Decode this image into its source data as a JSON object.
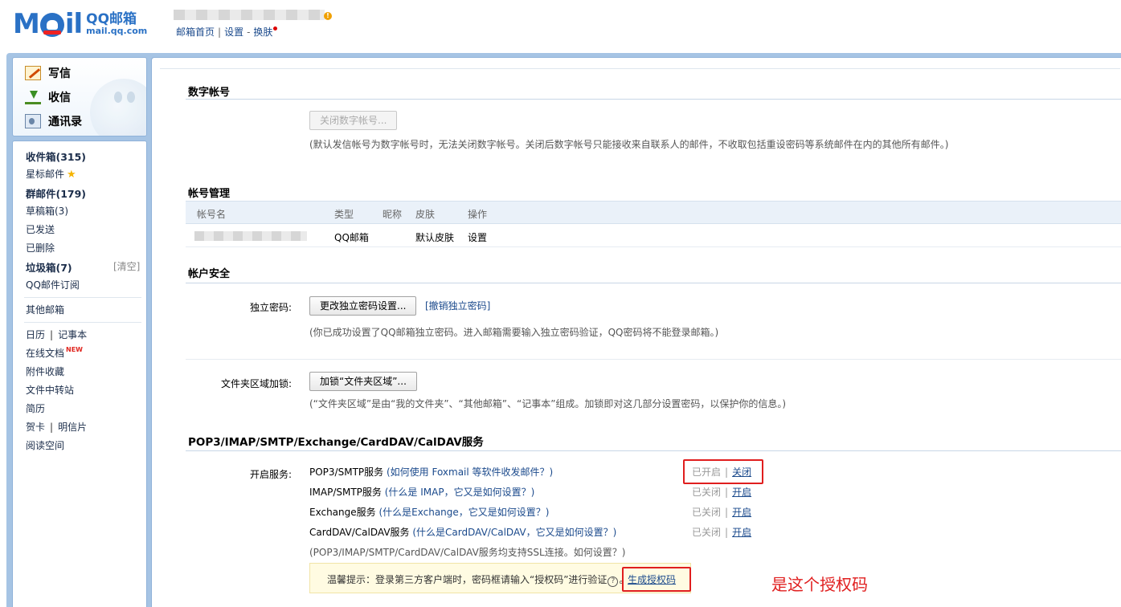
{
  "header": {
    "logo_word": "M",
    "logo_word_tail": "il",
    "logo_title": "QQ邮箱",
    "logo_domain": "mail.qq.com",
    "links": [
      "邮箱首页",
      "设置",
      "换肤"
    ],
    "sep_bar": "|",
    "sep_dash": "-"
  },
  "sidebar": {
    "quick": [
      {
        "label": "写信",
        "icon": "write-icon"
      },
      {
        "label": "收信",
        "icon": "inbox-download-icon"
      },
      {
        "label": "通讯录",
        "icon": "contacts-card-icon"
      }
    ],
    "folders": {
      "inbox": "收件箱(315)",
      "starred": "星标邮件",
      "group": "群邮件(179)",
      "drafts": "草稿箱(3)",
      "sent": "已发送",
      "deleted": "已删除",
      "spam": "垃圾箱(7)",
      "spam_clear": "[清空]",
      "subscription": "QQ邮件订阅",
      "other_mailbox": "其他邮箱",
      "calendar": "日历",
      "notes": "记事本",
      "docs": "在线文档",
      "docs_badge": "NEW",
      "attachments": "附件收藏",
      "transfer": "文件中转站",
      "resume": "简历",
      "greeting": "贺卡",
      "postcard": "明信片",
      "reading": "阅读空间",
      "pipe": "|"
    }
  },
  "main": {
    "digital": {
      "title": "数字帐号",
      "button": "关闭数字帐号...",
      "note": "(默认发信帐号为数字帐号时，无法关闭数字帐号。关闭后数字帐号只能接收来自联系人的邮件，不收取包括重设密码等系统邮件在内的其他所有邮件。)"
    },
    "accounts": {
      "title": "帐号管理",
      "headers": [
        "帐号名",
        "类型",
        "昵称",
        "皮肤",
        "操作"
      ],
      "row": {
        "type": "QQ邮箱",
        "skin": "默认皮肤",
        "action": "设置"
      }
    },
    "security": {
      "title": "帐户安全",
      "pwd_label": "独立密码:",
      "pwd_button": "更改独立密码设置...",
      "pwd_cancel": "[撤销独立密码]",
      "pwd_note": "(你已成功设置了QQ邮箱独立密码。进入邮箱需要输入独立密码验证，QQ密码将不能登录邮箱。)",
      "folder_label": "文件夹区域加锁:",
      "folder_button": "加锁“文件夹区域”...",
      "folder_note": "(“文件夹区域”是由“我的文件夹”、“其他邮箱”、“记事本”组成。加锁即对这几部分设置密码，以保护你的信息。)"
    },
    "services": {
      "title": "POP3/IMAP/SMTP/Exchange/CardDAV/CalDAV服务",
      "label": "开启服务:",
      "items": [
        {
          "name": "POP3/SMTP服务",
          "help": "(如何使用 Foxmail 等软件收发邮件？)",
          "state": "已开启",
          "action": "关闭"
        },
        {
          "name": "IMAP/SMTP服务",
          "help": "(什么是 IMAP，它又是如何设置？)",
          "state": "已关闭",
          "action": "开启"
        },
        {
          "name": "Exchange服务",
          "help": "(什么是Exchange，它又是如何设置？)",
          "state": "已关闭",
          "action": "开启"
        },
        {
          "name": "CardDAV/CalDAV服务",
          "help": "(什么是CardDAV/CalDAV，它又是如何设置？)",
          "state": "已关闭",
          "action": "开启"
        }
      ],
      "ssl_note": "(POP3/IMAP/SMTP/CardDAV/CalDAV服务均支持SSL连接。",
      "ssl_link": "如何设置？",
      "ssl_tail": ")",
      "pipe": "|",
      "tip_text": "温馨提示：登录第三方客户端时，密码框请输入“授权码”进行验证",
      "tip_q": "?",
      "tip_period": "。",
      "tip_link": "生成授权码"
    },
    "annotation": "是这个授权码"
  },
  "colors": {
    "brand": "#2a71c5",
    "link": "#1b4a8c",
    "highlight_red": "#e01e1e"
  }
}
